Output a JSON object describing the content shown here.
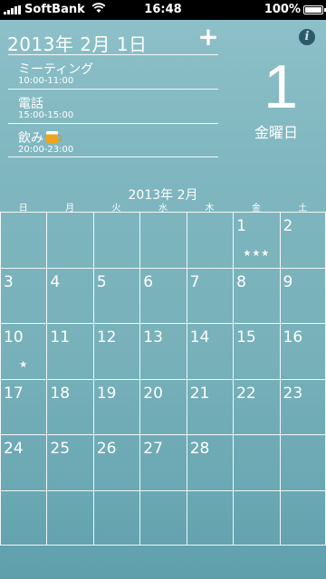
{
  "status": {
    "carrier": "SoftBank",
    "time": "16:48",
    "battery": "100%"
  },
  "header": {
    "date": "2013年 2月 1日",
    "add_symbol": "+",
    "info_symbol": "i"
  },
  "events": [
    {
      "title": "ミーティング",
      "time": "10:00-11:00"
    },
    {
      "title": "電話",
      "time": "15:00-15:00"
    },
    {
      "title": "飲み",
      "time": "20:00-23:00",
      "icon": "beer-icon"
    }
  ],
  "selected": {
    "day": "1",
    "weekday": "金曜日"
  },
  "calendar": {
    "month_label": "2013年 2月",
    "weekdays": [
      "日",
      "月",
      "火",
      "水",
      "木",
      "金",
      "土"
    ],
    "weeks": [
      [
        {
          "n": ""
        },
        {
          "n": ""
        },
        {
          "n": ""
        },
        {
          "n": ""
        },
        {
          "n": ""
        },
        {
          "n": "1",
          "m": "★★★"
        },
        {
          "n": "2"
        }
      ],
      [
        {
          "n": "3"
        },
        {
          "n": "4"
        },
        {
          "n": "5"
        },
        {
          "n": "6"
        },
        {
          "n": "7"
        },
        {
          "n": "8"
        },
        {
          "n": "9"
        }
      ],
      [
        {
          "n": "10",
          "m": "★"
        },
        {
          "n": "11"
        },
        {
          "n": "12"
        },
        {
          "n": "13"
        },
        {
          "n": "14"
        },
        {
          "n": "15"
        },
        {
          "n": "16"
        }
      ],
      [
        {
          "n": "17"
        },
        {
          "n": "18"
        },
        {
          "n": "19"
        },
        {
          "n": "20"
        },
        {
          "n": "21"
        },
        {
          "n": "22"
        },
        {
          "n": "23"
        }
      ],
      [
        {
          "n": "24"
        },
        {
          "n": "25"
        },
        {
          "n": "26"
        },
        {
          "n": "27"
        },
        {
          "n": "28"
        },
        {
          "n": ""
        },
        {
          "n": ""
        }
      ],
      [
        {
          "n": ""
        },
        {
          "n": ""
        },
        {
          "n": ""
        },
        {
          "n": ""
        },
        {
          "n": ""
        },
        {
          "n": ""
        },
        {
          "n": ""
        }
      ]
    ]
  }
}
